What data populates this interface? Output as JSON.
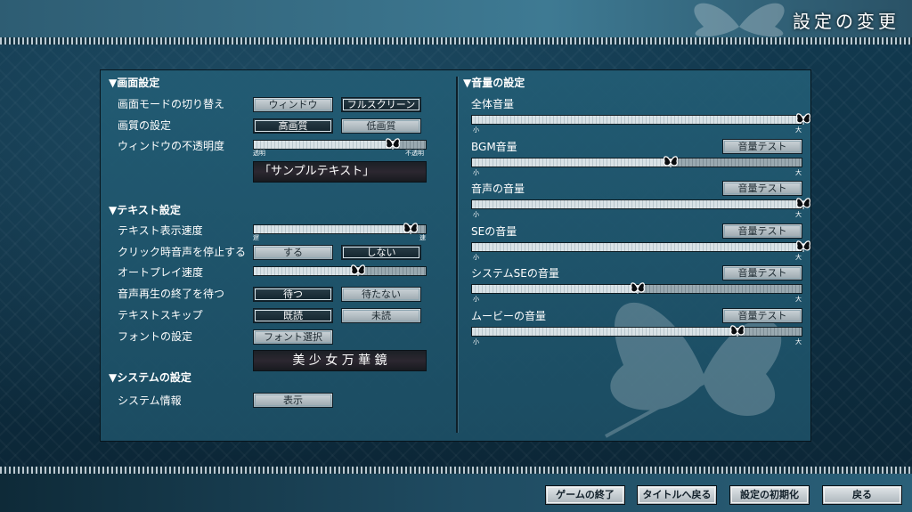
{
  "title": "設定の変更",
  "colors": {
    "panel": "#225c74",
    "button": "#b9c3c8",
    "button_selected": "#1c2f39",
    "background": "#0d2a3a"
  },
  "display": {
    "section_title": "▼画面設定",
    "screen_mode": {
      "label": "画面モードの切り替え",
      "options": [
        "ウィンドウ",
        "フルスクリーン"
      ],
      "selected": "フルスクリーン"
    },
    "image_quality": {
      "label": "画質の設定",
      "options": [
        "高画質",
        "低画質"
      ],
      "selected": "高画質"
    },
    "window_opacity": {
      "label": "ウィンドウの不透明度",
      "value": 0.8,
      "min_label": "透明",
      "max_label": "不透明",
      "knob_icon": "butterfly-icon"
    },
    "sample_text": "「サンプルテキスト」"
  },
  "text": {
    "section_title": "▼テキスト設定",
    "display_speed": {
      "label": "テキスト表示速度",
      "value": 0.9,
      "min_label": "遅",
      "max_label": "速"
    },
    "stop_voice_on_click": {
      "label": "クリック時音声を停止する",
      "options": [
        "する",
        "しない"
      ],
      "selected": "しない"
    },
    "auto_play_speed": {
      "label": "オートプレイ速度",
      "value": 0.6
    },
    "wait_voice_end": {
      "label": "音声再生の終了を待つ",
      "options": [
        "待つ",
        "待たない"
      ],
      "selected": "待つ"
    },
    "text_skip": {
      "label": "テキストスキップ",
      "options": [
        "既読",
        "未読"
      ],
      "selected": "既読"
    },
    "font": {
      "label": "フォントの設定",
      "button": "フォント選択"
    },
    "font_sample": "美 少 女 万 華 鏡"
  },
  "system": {
    "section_title": "▼システムの設定",
    "info": {
      "label": "システム情報",
      "button": "表示"
    }
  },
  "audio": {
    "section_title": "▼音量の設定",
    "min_label": "小",
    "max_label": "大",
    "test_button": "音量テスト",
    "channels": [
      {
        "label": "全体音量",
        "value": 1.0,
        "has_test": false
      },
      {
        "label": "BGM音量",
        "value": 0.6,
        "has_test": true
      },
      {
        "label": "音声の音量",
        "value": 1.0,
        "has_test": true
      },
      {
        "label": "SEの音量",
        "value": 1.0,
        "has_test": true
      },
      {
        "label": "システムSEの音量",
        "value": 0.5,
        "has_test": true
      },
      {
        "label": "ムービーの音量",
        "value": 0.8,
        "has_test": true
      }
    ]
  },
  "footer": {
    "end_game": "ゲームの終了",
    "to_title": "タイトルへ戻る",
    "reset": "設定の初期化",
    "back": "戻る"
  }
}
